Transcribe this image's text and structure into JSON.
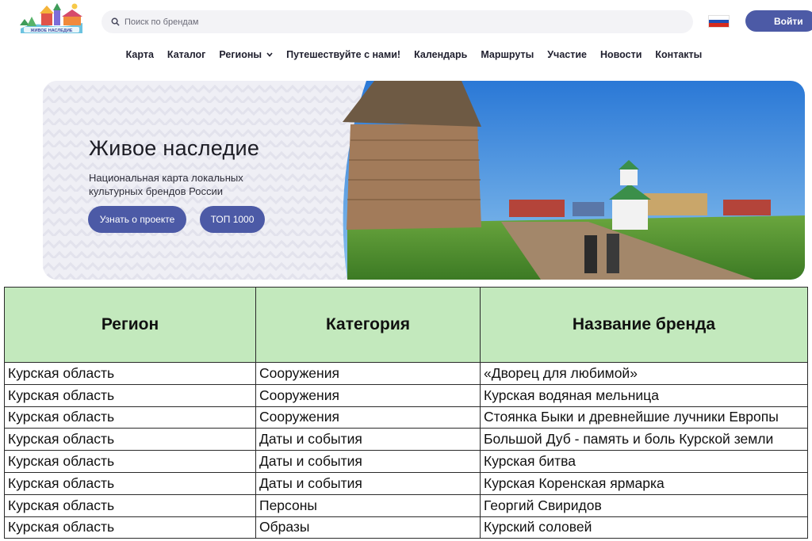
{
  "header": {
    "search_placeholder": "Поиск по брендам",
    "login_label": "Войти",
    "flag_colors": [
      "#ffffff",
      "#1f4fb5",
      "#d52b1e"
    ]
  },
  "nav": {
    "items": [
      {
        "label": "Карта"
      },
      {
        "label": "Каталог"
      },
      {
        "label": "Регионы",
        "has_dropdown": true
      },
      {
        "label": "Путешествуйте с нами!"
      },
      {
        "label": "Календарь"
      },
      {
        "label": "Маршруты"
      },
      {
        "label": "Участие"
      },
      {
        "label": "Новости"
      },
      {
        "label": "Контакты"
      }
    ]
  },
  "hero": {
    "title": "Живое наследие",
    "subtitle": "Национальная карта локальных культурных брендов России",
    "about_button": "Узнать о проекте",
    "top_button": "ТОП 1000"
  },
  "table": {
    "headers": [
      "Регион",
      "Категория",
      "Название бренда"
    ],
    "rows": [
      [
        "Курская область",
        "Сооружения",
        "«Дворец для любимой»"
      ],
      [
        "Курская область",
        "Сооружения",
        "Курская водяная мельница"
      ],
      [
        "Курская область",
        "Сооружения",
        "Стоянка Быки и древнейшие лучники Европы"
      ],
      [
        "Курская область",
        "Даты и события",
        "Большой Дуб - память и боль Курской земли"
      ],
      [
        "Курская область",
        "Даты и события",
        "Курская битва"
      ],
      [
        "Курская область",
        "Даты и события",
        "Курская Коренская ярмарка"
      ],
      [
        "Курская область",
        "Персоны",
        "Георгий Свиридов"
      ],
      [
        "Курская область",
        "Образы",
        "Курский соловей"
      ]
    ]
  },
  "colors": {
    "accent": "#4c5aa6",
    "table_header_bg": "#c3e9bd"
  }
}
